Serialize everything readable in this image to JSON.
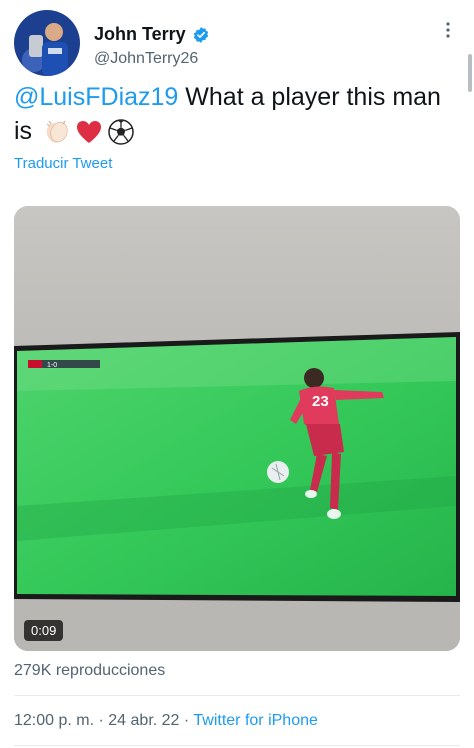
{
  "author": {
    "name": "John Terry",
    "handle": "@JohnTerry26",
    "verified": true,
    "avatar_icon": "profile-photo"
  },
  "tweet": {
    "mention": "@LuisFDiaz19",
    "text_after_mention": " What a player this man",
    "text_line2": "is",
    "emojis": [
      "clapping-hands-emoji",
      "red-heart-emoji",
      "soccer-ball-emoji"
    ],
    "translate_label": "Traducir Tweet"
  },
  "media": {
    "duration": "0:09",
    "scoreboard": "1-0",
    "jersey_number": "23"
  },
  "stats": {
    "views": "279K reproducciones"
  },
  "meta": {
    "time": "12:00 p. m.",
    "separator": "·",
    "date": "24 abr. 22",
    "source": "Twitter for iPhone"
  },
  "colors": {
    "link": "#1d9bf0",
    "secondary_text": "#536471",
    "pitch": "#35c95a"
  }
}
